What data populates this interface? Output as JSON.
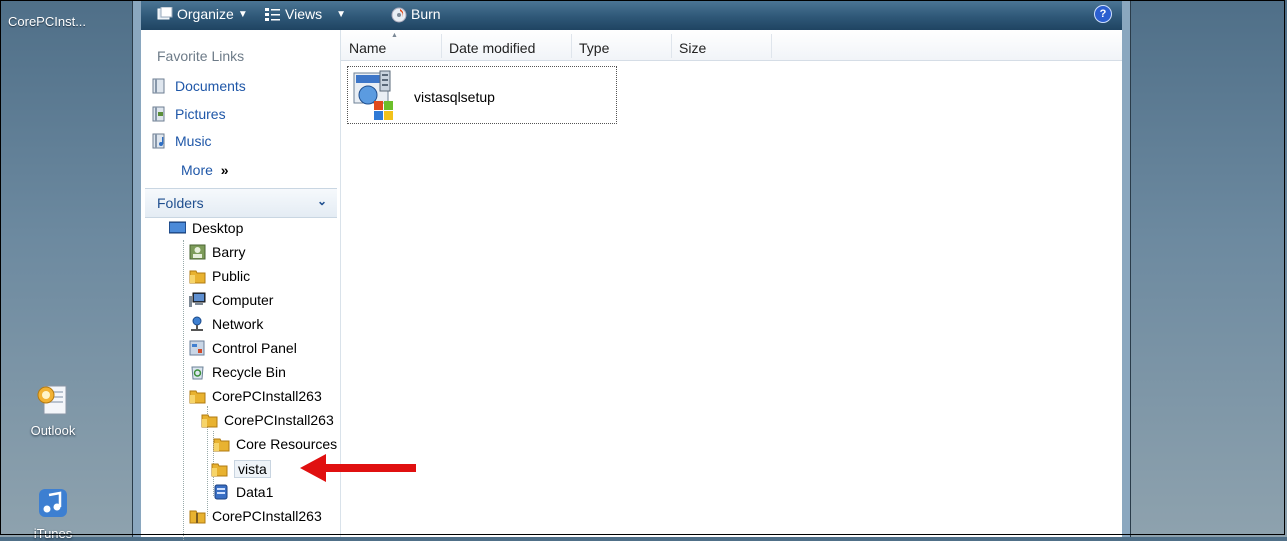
{
  "desktop": {
    "top_label": "CorePCInst...",
    "icons": [
      {
        "label": "Outlook",
        "icon": "outlook-icon"
      },
      {
        "label": "iTunes",
        "icon": "itunes-icon"
      }
    ]
  },
  "toolbar": {
    "organize": "Organize",
    "views": "Views",
    "burn": "Burn",
    "help": "?"
  },
  "nav": {
    "favorites_heading": "Favorite Links",
    "favorites": [
      {
        "label": "Documents",
        "icon": "documents-icon"
      },
      {
        "label": "Pictures",
        "icon": "pictures-icon"
      },
      {
        "label": "Music",
        "icon": "music-icon"
      }
    ],
    "more": "More",
    "folders_heading": "Folders",
    "tree": [
      {
        "label": "Desktop",
        "icon": "desktop-icon"
      },
      {
        "label": "Barry",
        "icon": "user-folder-icon"
      },
      {
        "label": "Public",
        "icon": "folder-icon"
      },
      {
        "label": "Computer",
        "icon": "computer-icon"
      },
      {
        "label": "Network",
        "icon": "network-icon"
      },
      {
        "label": "Control Panel",
        "icon": "control-panel-icon"
      },
      {
        "label": "Recycle Bin",
        "icon": "recycle-bin-icon"
      },
      {
        "label": "CorePCInstall263",
        "icon": "folder-icon"
      },
      {
        "label": "CorePCInstall263",
        "icon": "folder-icon"
      },
      {
        "label": "Core Resources",
        "icon": "folder-icon"
      },
      {
        "label": "vista",
        "icon": "folder-icon"
      },
      {
        "label": "Data1",
        "icon": "data-file-icon"
      },
      {
        "label": "CorePCInstall263",
        "icon": "zip-folder-icon"
      }
    ]
  },
  "columns": [
    "Name",
    "Date modified",
    "Type",
    "Size"
  ],
  "files": [
    {
      "name": "vistasqlsetup",
      "icon": "setup-installer-icon"
    }
  ],
  "colors": {
    "toolbar": "#2f5878",
    "link": "#1f57a8",
    "arrow": "#e01010"
  }
}
